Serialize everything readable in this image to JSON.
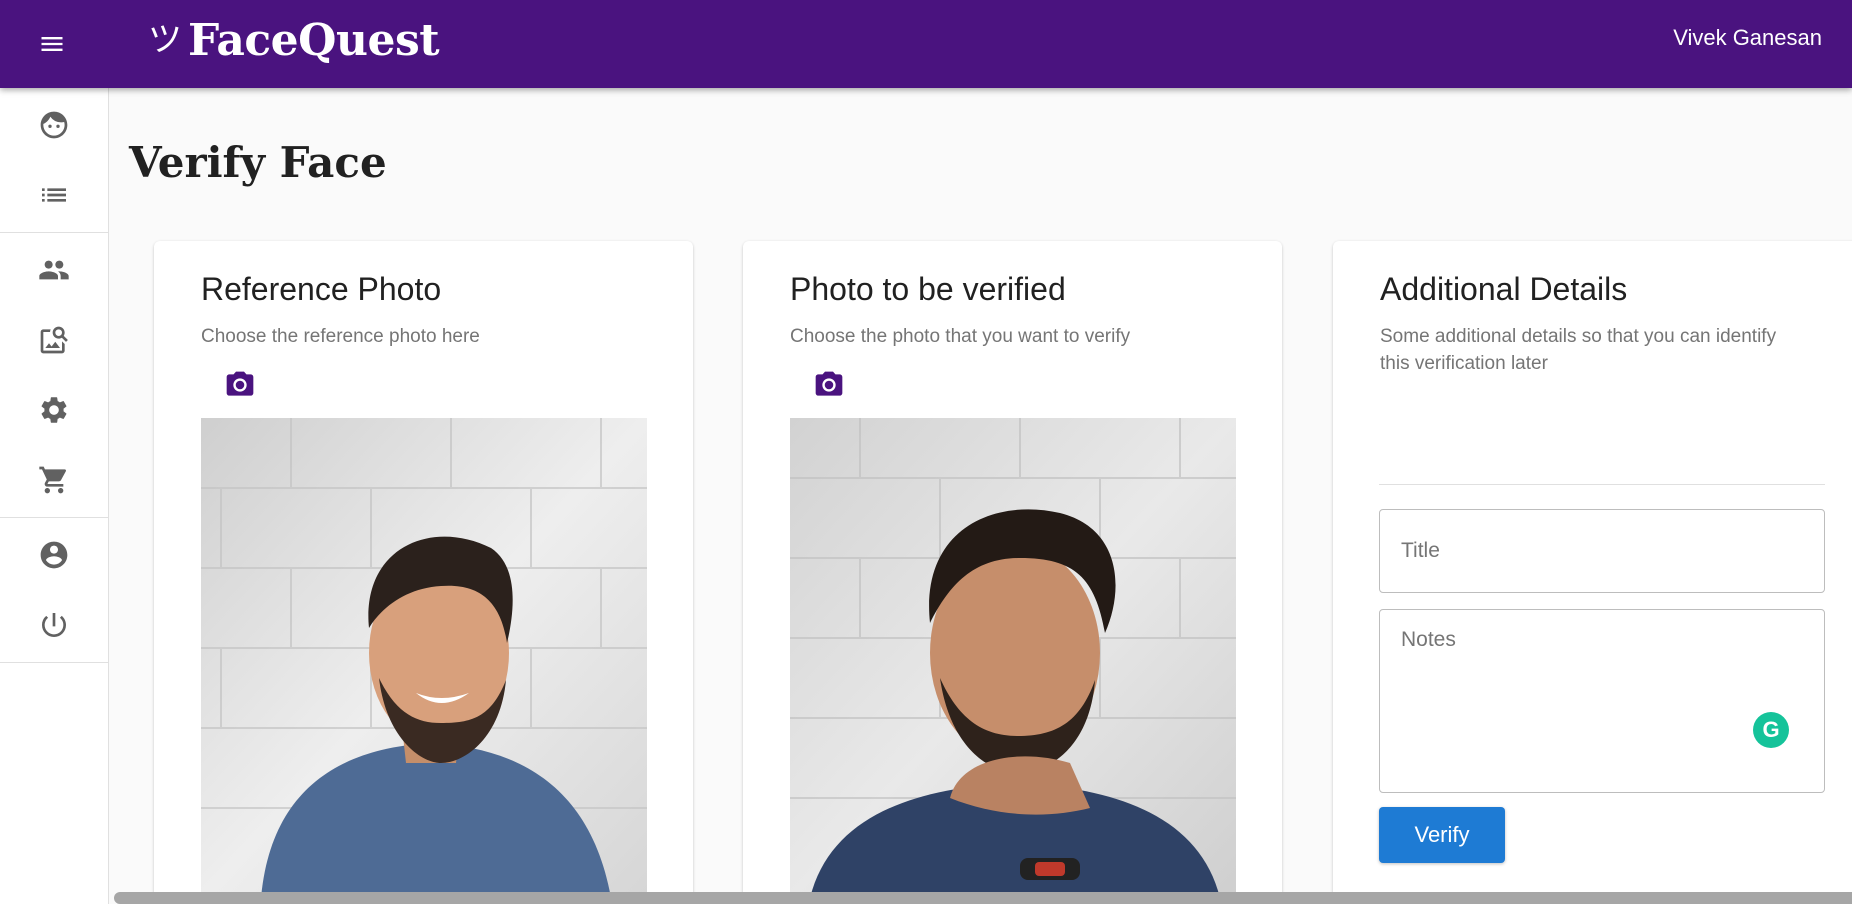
{
  "header": {
    "menu_icon": "menu-icon",
    "brand_mark": "ツ",
    "brand_name": "FaceQuest",
    "user_name": "Vivek Ganesan",
    "background": "#4a137f"
  },
  "sidebar": {
    "groups": [
      {
        "items": [
          {
            "icon": "face-icon"
          },
          {
            "icon": "list-icon"
          }
        ]
      },
      {
        "items": [
          {
            "icon": "people-icon"
          },
          {
            "icon": "image-search-icon"
          },
          {
            "icon": "settings-icon"
          },
          {
            "icon": "cart-icon"
          }
        ]
      },
      {
        "items": [
          {
            "icon": "account-icon"
          },
          {
            "icon": "power-icon"
          }
        ]
      }
    ]
  },
  "page": {
    "title": "Verify Face"
  },
  "reference_card": {
    "title": "Reference Photo",
    "subtitle": "Choose the reference photo here",
    "camera_icon": "camera-icon"
  },
  "verify_card": {
    "title": "Photo to be verified",
    "subtitle": "Choose the photo that you want to verify",
    "camera_icon": "camera-icon"
  },
  "details_card": {
    "title": "Additional Details",
    "subtitle": "Some additional details so that you can identify this verification later",
    "title_placeholder": "Title",
    "notes_placeholder": "Notes",
    "grammarly_icon": "grammarly-icon",
    "grammarly_letter": "G",
    "verify_label": "Verify"
  },
  "colors": {
    "primary": "#4a137f",
    "accent_button": "#1e7bd4",
    "grammarly": "#15c39a"
  }
}
